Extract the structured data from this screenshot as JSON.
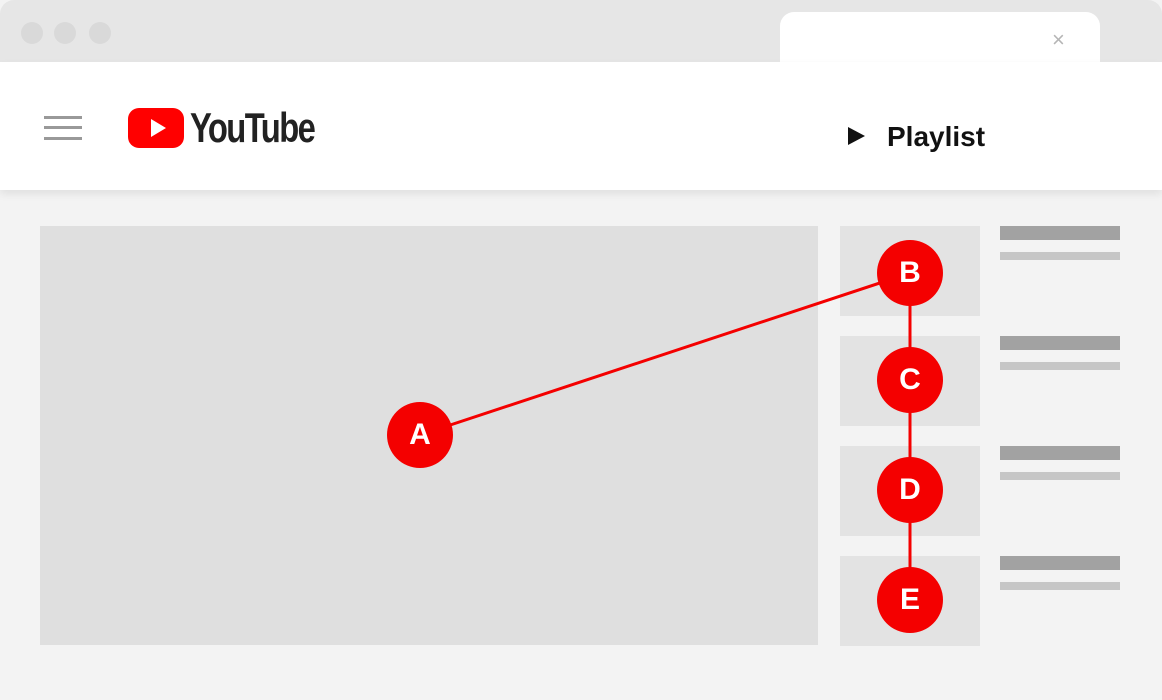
{
  "browser": {
    "tab_close": "×"
  },
  "header": {
    "logo_text": "YouTube",
    "playlist_label": "Playlist"
  },
  "markers": [
    "A",
    "B",
    "C",
    "D",
    "E"
  ],
  "colors": {
    "accent": "#ff0000",
    "marker": "#f40000"
  }
}
